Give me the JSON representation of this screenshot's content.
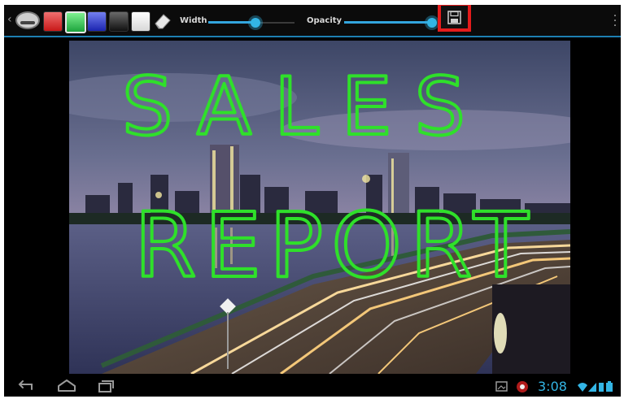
{
  "toolbar": {
    "colors": [
      {
        "name": "red",
        "hex": "#d42a2a"
      },
      {
        "name": "green",
        "hex": "#2ec84a"
      },
      {
        "name": "blue",
        "hex": "#2b36c8"
      },
      {
        "name": "black",
        "hex": "#222222"
      },
      {
        "name": "white",
        "hex": "#f2f2f2"
      }
    ],
    "selected_color": "green",
    "width_label": "Width",
    "opacity_label": "Opacity",
    "width_value": 0.55,
    "opacity_value": 0.97
  },
  "drawing": {
    "line1": "SALES",
    "line2": "REPORT",
    "ink_color": "#2fe02a"
  },
  "statusbar": {
    "time": "3:08"
  },
  "icons": {
    "back": "back-arrow-icon",
    "home": "home-icon",
    "recent": "recent-apps-icon",
    "gallery": "gallery-icon",
    "notification": "notification-icon",
    "wifi": "wifi-icon",
    "signal": "signal-icon",
    "battery": "battery-icon",
    "save": "save-icon",
    "eraser": "eraser-icon",
    "overflow": "overflow-menu-icon"
  }
}
